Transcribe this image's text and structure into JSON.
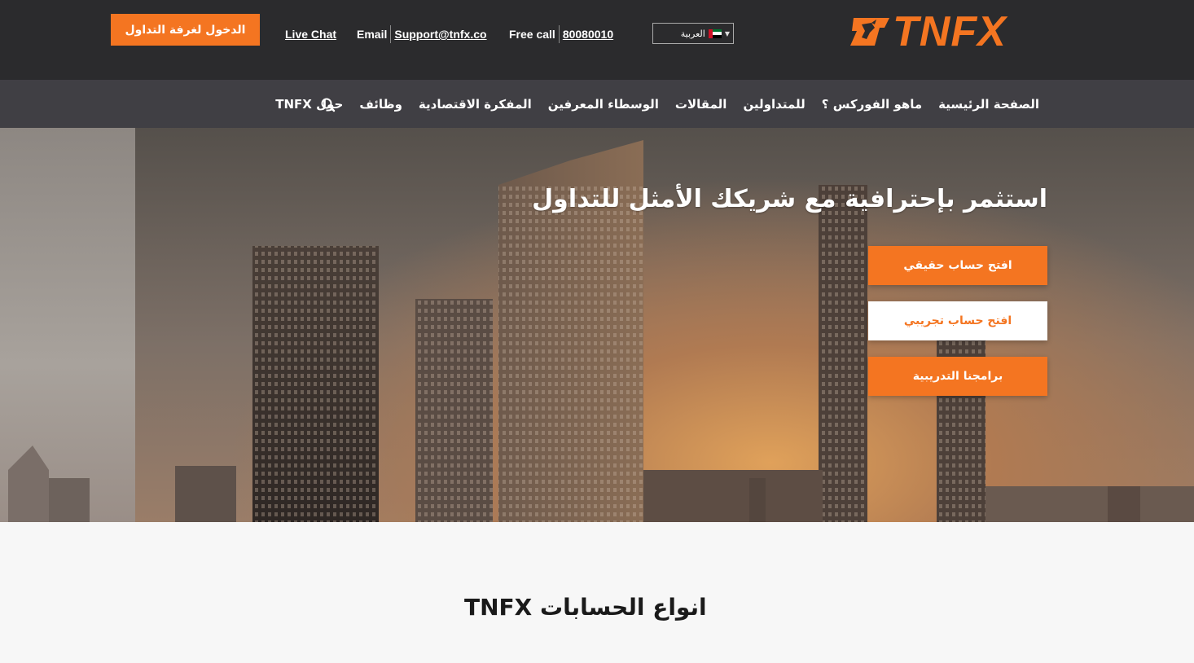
{
  "topbar": {
    "login_label": "الدخول لغرفة التداول",
    "live_chat": "Live Chat",
    "email_label": "Email",
    "email_value": "Support@tnfx.co",
    "free_call_label": "Free call",
    "free_call_value": "80080010",
    "language": "العربية",
    "logo_text": "TNFX"
  },
  "nav": {
    "items": [
      "الصفحة الرئيسية",
      "ماهو الفوركس ؟",
      "للمتداولين",
      "المقالات",
      "الوسطاء المعرفين",
      "المفكرة الاقتصادية",
      "وظائف",
      "حول TNFX"
    ],
    "search_icon": "search-icon"
  },
  "hero": {
    "title": "استثمر بإحترافية مع شريكك الأمثل للتداول",
    "buttons": {
      "real_account": "افتح حساب حقيقي",
      "demo_account": "افتح حساب تجريبي",
      "training": "برامجنا التدريبية"
    }
  },
  "section": {
    "title": "انواع الحسابات TNFX"
  },
  "colors": {
    "accent": "#f47521",
    "topbar_bg": "#2b2b2d",
    "nav_bg": "#403f44"
  }
}
